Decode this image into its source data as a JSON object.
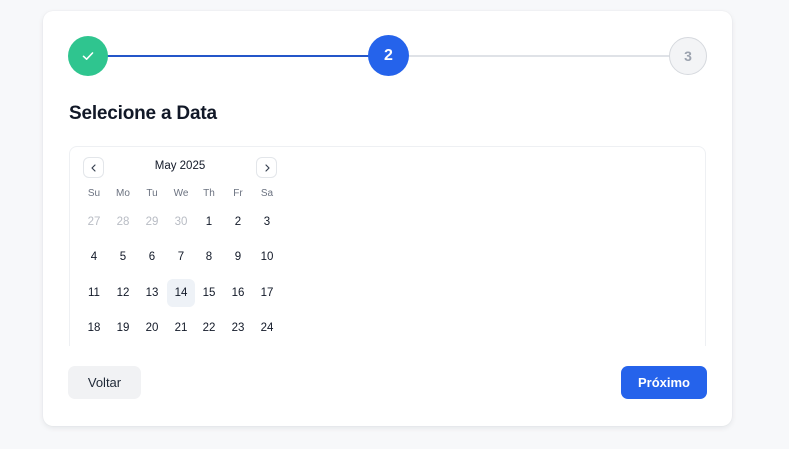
{
  "stepper": {
    "step1_state": "completed",
    "step2_label": "2",
    "step3_label": "3",
    "current_step": 2,
    "colors": {
      "done": "#2fc58f",
      "active": "#2563eb",
      "inactive": "#d6d9de"
    }
  },
  "title": "Selecione a Data",
  "calendar": {
    "month_label": "May 2025",
    "weekdays": [
      "Su",
      "Mo",
      "Tu",
      "We",
      "Th",
      "Fr",
      "Sa"
    ],
    "weeks": [
      [
        {
          "d": "27",
          "muted": true
        },
        {
          "d": "28",
          "muted": true
        },
        {
          "d": "29",
          "muted": true
        },
        {
          "d": "30",
          "muted": true
        },
        {
          "d": "1"
        },
        {
          "d": "2"
        },
        {
          "d": "3"
        }
      ],
      [
        {
          "d": "4"
        },
        {
          "d": "5"
        },
        {
          "d": "6"
        },
        {
          "d": "7"
        },
        {
          "d": "8"
        },
        {
          "d": "9"
        },
        {
          "d": "10"
        }
      ],
      [
        {
          "d": "11"
        },
        {
          "d": "12"
        },
        {
          "d": "13"
        },
        {
          "d": "14",
          "today": true
        },
        {
          "d": "15"
        },
        {
          "d": "16"
        },
        {
          "d": "17"
        }
      ],
      [
        {
          "d": "18"
        },
        {
          "d": "19"
        },
        {
          "d": "20"
        },
        {
          "d": "21"
        },
        {
          "d": "22"
        },
        {
          "d": "23"
        },
        {
          "d": "24"
        }
      ]
    ]
  },
  "buttons": {
    "back_label": "Voltar",
    "next_label": "Próximo"
  }
}
